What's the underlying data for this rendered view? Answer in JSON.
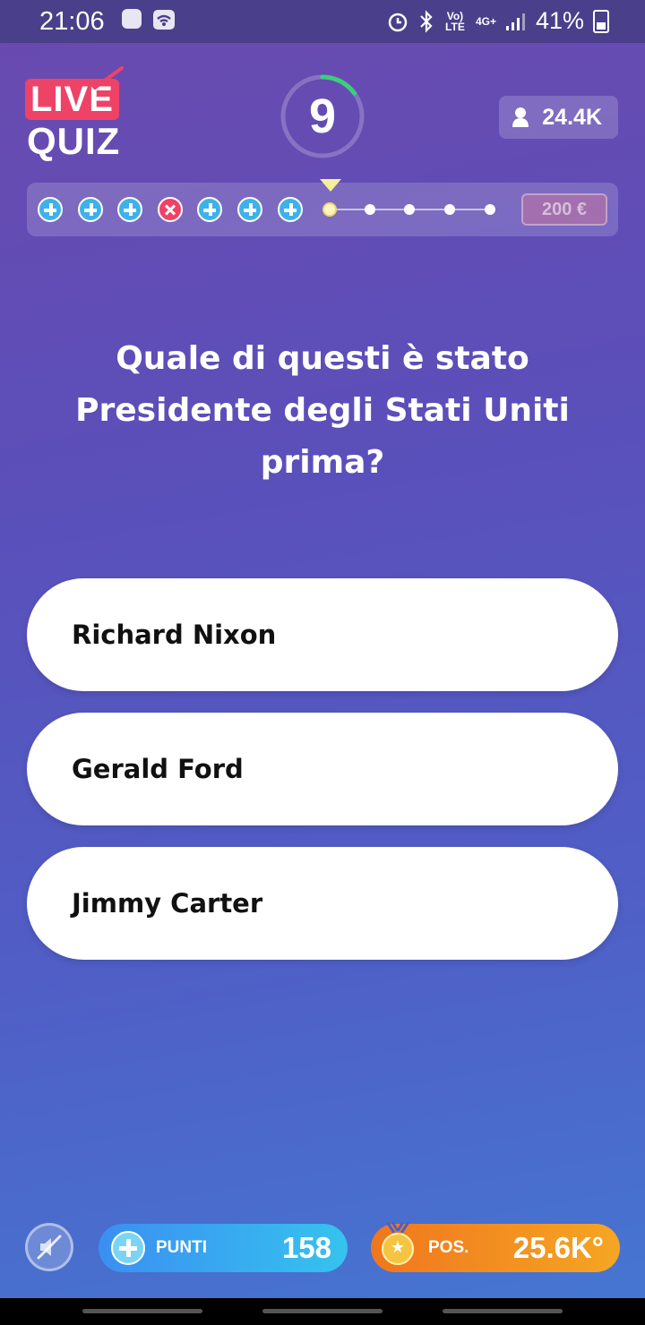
{
  "status_bar": {
    "time": "21:06",
    "network": "4G+",
    "volte": "Vo) LTE",
    "battery": "41%",
    "icons": [
      "game-icon",
      "wifi-icon",
      "alarm-icon",
      "bluetooth-icon",
      "signal-icon",
      "battery-icon"
    ]
  },
  "logo": {
    "line1": "LIVE",
    "line2": "QUIZ"
  },
  "timer": {
    "value": "9",
    "ring_fraction": 0.15,
    "ring_color": "#3ad07a"
  },
  "players": {
    "count": "24.4K",
    "icon": "user-icon"
  },
  "progress": {
    "steps": [
      "correct",
      "correct",
      "correct",
      "wrong",
      "correct",
      "correct",
      "correct",
      "current",
      "pending",
      "pending",
      "pending",
      "pending"
    ],
    "prize": "200 €"
  },
  "question": {
    "text": "Quale di questi è stato Presidente degli Stati Uniti prima?"
  },
  "answers": [
    {
      "label": "Richard Nixon"
    },
    {
      "label": "Gerald Ford"
    },
    {
      "label": "Jimmy Carter"
    }
  ],
  "bottom_bar": {
    "sound_icon": "sound-off-icon",
    "points_label": "PUNTI",
    "points_value": "158",
    "position_label": "POS.",
    "position_value": "25.6K°"
  },
  "colors": {
    "accent_pink": "#ef4267",
    "correct_blue": "#3fb1ea",
    "points_blue": "#3a8ff0",
    "position_orange": "#f0761e"
  }
}
